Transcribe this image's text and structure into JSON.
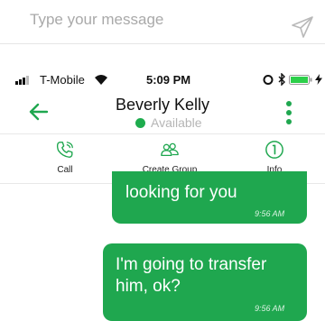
{
  "composer": {
    "placeholder": "Type your message",
    "send_icon": "send-icon"
  },
  "status_bar": {
    "carrier": "T-Mobile",
    "time": "5:09 PM"
  },
  "header": {
    "contact_name": "Beverly Kelly",
    "presence": "Available",
    "presence_color": "#1eac4e"
  },
  "actions": [
    {
      "label": "Call",
      "icon": "phone-icon"
    },
    {
      "label": "Create Group",
      "icon": "group-icon"
    },
    {
      "label": "Info",
      "icon": "info-icon"
    }
  ],
  "messages": [
    {
      "text": "looking for you",
      "time": "9:56 AM"
    },
    {
      "text_line1": "I'm going to transfer",
      "text_line2": "him, ok?",
      "time": "9:56 AM"
    }
  ],
  "colors": {
    "accent": "#1fa74f",
    "text_muted": "#a9a9a9"
  }
}
